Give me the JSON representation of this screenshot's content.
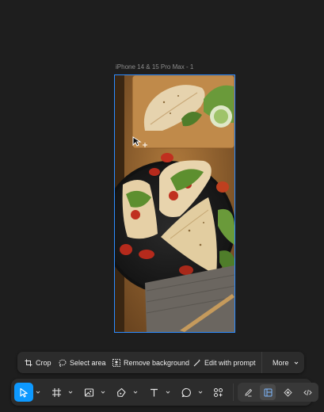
{
  "frame": {
    "label": "iPhone 14 & 15 Pro Max - 1"
  },
  "image_toolbar": {
    "crop_label": "Crop",
    "select_area_label": "Select area",
    "remove_background_label": "Remove background",
    "edit_with_prompt_label": "Edit with prompt",
    "more_label": "More"
  },
  "main_toolbar": {
    "tools": [
      "move-tool",
      "frame-tool",
      "image-tool",
      "pen-tool",
      "text-tool",
      "comment-tool",
      "actions-tool"
    ],
    "active_tool": "move-tool",
    "modes": [
      "design-mode",
      "draw-mode",
      "prototype-mode",
      "dev-mode"
    ],
    "selected_mode": "draw-mode"
  },
  "colors": {
    "canvas": "#1e1e1e",
    "toolbar": "#2c2c2c",
    "accent": "#0d99ff",
    "selection": "#2d8cff"
  }
}
